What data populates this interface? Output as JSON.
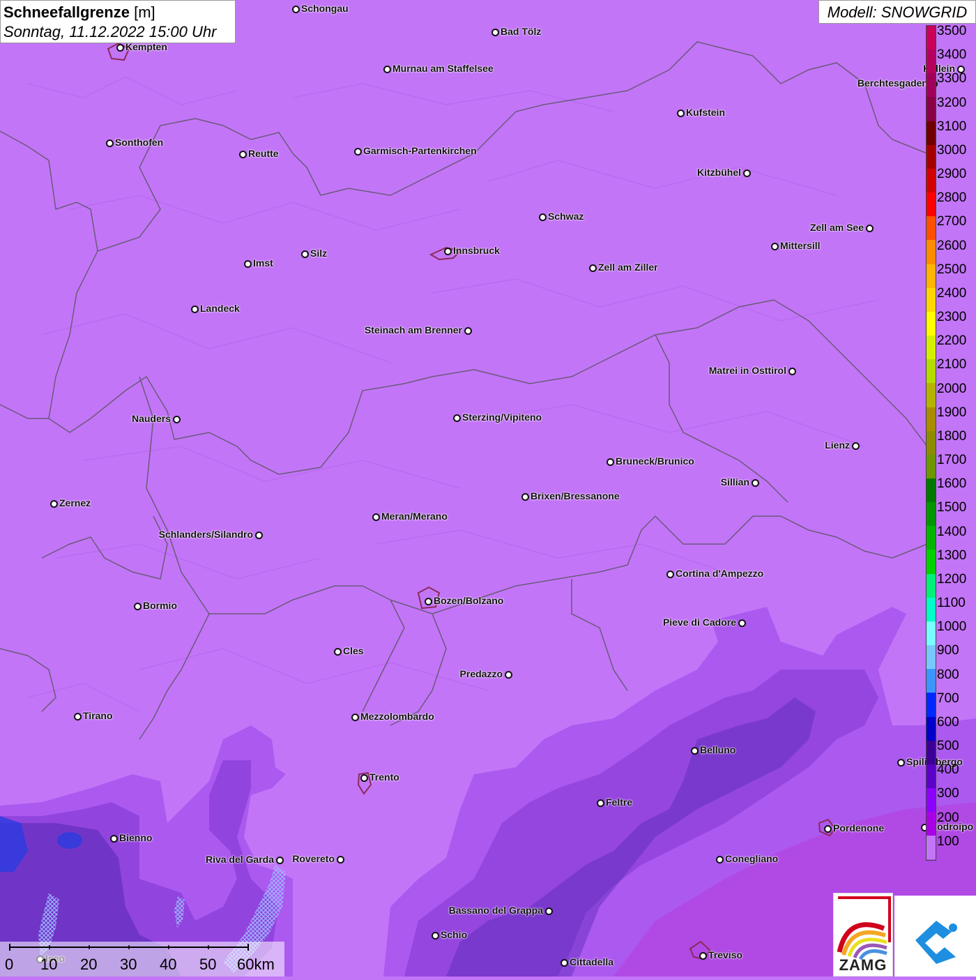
{
  "title": {
    "label_bold": "Schneefallgrenze",
    "label_unit": "[m]",
    "datetime": "Sonntag, 11.12.2022 15:00 Uhr"
  },
  "model": "Modell: SNOWGRID",
  "legend": {
    "labels": [
      "3500",
      "3400",
      "3300",
      "3200",
      "3100",
      "3000",
      "2900",
      "2800",
      "2700",
      "2600",
      "2500",
      "2400",
      "2300",
      "2200",
      "2100",
      "2000",
      "1900",
      "1800",
      "1700",
      "1600",
      "1500",
      "1400",
      "1300",
      "1200",
      "1100",
      "1000",
      "900",
      "800",
      "700",
      "600",
      "500",
      "400",
      "300",
      "200",
      "100"
    ],
    "colors": [
      "#c8005a",
      "#b5005e",
      "#a0005a",
      "#8a0046",
      "#700000",
      "#a50000",
      "#d20000",
      "#ff0000",
      "#ff5000",
      "#ff8c00",
      "#ffb400",
      "#ffd700",
      "#ffff00",
      "#d4f000",
      "#b4dc00",
      "#b4b400",
      "#aa8c00",
      "#8c8c00",
      "#6e9600",
      "#007800",
      "#009600",
      "#00b400",
      "#00d200",
      "#00f078",
      "#00ffc8",
      "#78ffff",
      "#78c8ff",
      "#3c96ff",
      "#0028ff",
      "#0000c8",
      "#3c0096",
      "#5a00c8",
      "#8c00ff",
      "#aa00e6",
      "#c375f8"
    ]
  },
  "scale": {
    "labels": [
      "0",
      "10",
      "20",
      "30",
      "40",
      "50",
      "60km"
    ]
  },
  "logo": {
    "zamg": "ZAMG"
  },
  "places": [
    {
      "name": "Schongau",
      "side": "r"
    },
    {
      "name": "Bad Tölz",
      "side": "r"
    },
    {
      "name": "Kempten",
      "side": "r"
    },
    {
      "name": "Murnau am Staffelsee",
      "side": "r"
    },
    {
      "name": "Hallein",
      "side": "l"
    },
    {
      "name": "Berchtesgaden",
      "side": "l"
    },
    {
      "name": "Kufstein",
      "side": "r"
    },
    {
      "name": "Sonthofen",
      "side": "r"
    },
    {
      "name": "Reutte",
      "side": "r"
    },
    {
      "name": "Garmisch-Partenkirchen",
      "side": "r"
    },
    {
      "name": "Kitzbühel",
      "side": "l"
    },
    {
      "name": "Schwaz",
      "side": "r"
    },
    {
      "name": "Zell am See",
      "side": "l"
    },
    {
      "name": "Innsbruck",
      "side": "r"
    },
    {
      "name": "Mittersill",
      "side": "r"
    },
    {
      "name": "Imst",
      "side": "r"
    },
    {
      "name": "Silz",
      "side": "r"
    },
    {
      "name": "Zell am Ziller",
      "side": "r"
    },
    {
      "name": "Landeck",
      "side": "r"
    },
    {
      "name": "Steinach am Brenner",
      "side": "l"
    },
    {
      "name": "Matrei in Osttirol",
      "side": "l"
    },
    {
      "name": "Nauders",
      "side": "l"
    },
    {
      "name": "Sterzing/Vipiteno",
      "side": "r"
    },
    {
      "name": "Lienz",
      "side": "l"
    },
    {
      "name": "Bruneck/Brunico",
      "side": "r"
    },
    {
      "name": "Sillian",
      "side": "l"
    },
    {
      "name": "Zernez",
      "side": "r"
    },
    {
      "name": "Brixen/Bressanone",
      "side": "r"
    },
    {
      "name": "Meran/Merano",
      "side": "r"
    },
    {
      "name": "Schlanders/Silandro",
      "side": "l"
    },
    {
      "name": "Cortina d'Ampezzo",
      "side": "r"
    },
    {
      "name": "Bozen/Bolzano",
      "side": "r"
    },
    {
      "name": "Bormio",
      "side": "r"
    },
    {
      "name": "Pieve di Cadore",
      "side": "l"
    },
    {
      "name": "Cles",
      "side": "r"
    },
    {
      "name": "Predazzo",
      "side": "l"
    },
    {
      "name": "Tirano",
      "side": "r"
    },
    {
      "name": "Mezzolombardo",
      "side": "r"
    },
    {
      "name": "Belluno",
      "side": "r"
    },
    {
      "name": "Spilimbergo",
      "side": "r"
    },
    {
      "name": "Trento",
      "side": "r"
    },
    {
      "name": "Feltre",
      "side": "r"
    },
    {
      "name": "Pordenone",
      "side": "r"
    },
    {
      "name": "Codroipo",
      "side": "r"
    },
    {
      "name": "Bienno",
      "side": "r"
    },
    {
      "name": "Riva del Garda",
      "side": "l"
    },
    {
      "name": "Rovereto",
      "side": "l"
    },
    {
      "name": "Conegliano",
      "side": "r"
    },
    {
      "name": "Bassano del Grappa",
      "side": "l"
    },
    {
      "name": "Schio",
      "side": "r"
    },
    {
      "name": "Iseo",
      "side": "r"
    },
    {
      "name": "Treviso",
      "side": "r"
    },
    {
      "name": "Cittadella",
      "side": "r"
    }
  ]
}
